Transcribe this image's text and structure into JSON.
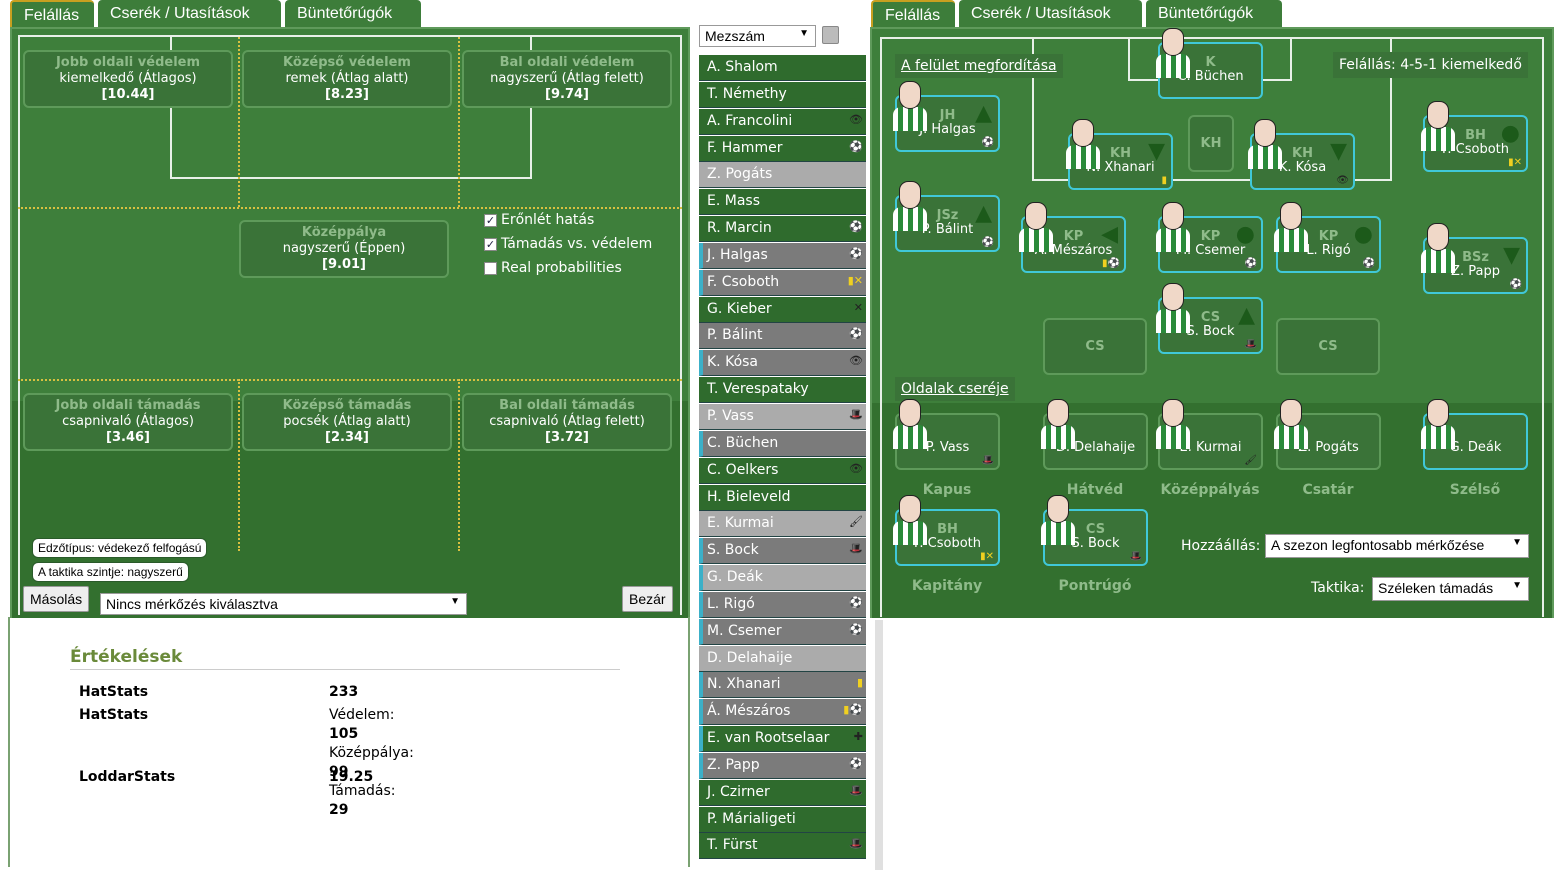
{
  "left": {
    "tabs": [
      "Felállás",
      "Cserék / Utasítások",
      "Büntetőrúgók"
    ],
    "ratings": [
      {
        "title": "Jobb oldali védelem",
        "level": "kiemelkedő (Átlagos)",
        "value": "[10.44]"
      },
      {
        "title": "Középső védelem",
        "level": "remek (Átlag alatt)",
        "value": "[8.23]"
      },
      {
        "title": "Bal oldali védelem",
        "level": "nagyszerű (Átlag felett)",
        "value": "[9.74]"
      },
      {
        "title": "Középpálya",
        "level": "nagyszerű (Éppen)",
        "value": "[9.01]"
      },
      {
        "title": "Jobb oldali támadás",
        "level": "csapnivaló (Átlagos)",
        "value": "[3.46]"
      },
      {
        "title": "Középső támadás",
        "level": "pocsék (Átlag alatt)",
        "value": "[2.34]"
      },
      {
        "title": "Bal oldali támadás",
        "level": "csapnivaló (Átlag felett)",
        "value": "[3.72]"
      }
    ],
    "checkboxes": [
      {
        "label": "Erőnlét hatás",
        "checked": true
      },
      {
        "label": "Támadás vs. védelem",
        "checked": true
      },
      {
        "label": "Real probabilities",
        "checked": false
      }
    ],
    "coach": "Edzőtípus: védekező felfogású",
    "tactic_level": "A taktika szintje: nagyszerű",
    "copy_button": "Másolás",
    "match_select": "Nincs mérkőzés kiválasztva",
    "close_button": "Bezár",
    "ratings_section": {
      "title": "Értékelések",
      "rows": [
        {
          "label": "HatStats",
          "value": "233"
        },
        {
          "label": "HatStats",
          "lines": [
            {
              "k": "Védelem:",
              "v": "105"
            },
            {
              "k": "Középpálya:",
              "v": "99"
            },
            {
              "k": "Támadás:",
              "v": "29"
            }
          ]
        },
        {
          "label": "LoddarStats",
          "value": "19.25"
        }
      ]
    }
  },
  "list": {
    "sort_select": "Mezszám",
    "players": [
      {
        "name": "A. Shalom",
        "style": "g"
      },
      {
        "name": "T. Némethy",
        "style": "g"
      },
      {
        "name": "A. Francolini",
        "style": "g",
        "icon": "eye"
      },
      {
        "name": "F. Hammer",
        "style": "g",
        "icon": "head"
      },
      {
        "name": "Z. Pogáts",
        "style": "l"
      },
      {
        "name": "E. Mass",
        "style": "g"
      },
      {
        "name": "R. Marcin",
        "style": "g",
        "icon": "head"
      },
      {
        "name": "J. Halgas",
        "style": "d",
        "sel": true,
        "icon": "head"
      },
      {
        "name": "F. Csoboth",
        "style": "d",
        "sel": true,
        "icon": "card-captain"
      },
      {
        "name": "G. Kieber",
        "style": "g",
        "icon": "captain"
      },
      {
        "name": "P. Bálint",
        "style": "d",
        "icon": "head"
      },
      {
        "name": "K. Kósa",
        "style": "d",
        "sel": true,
        "icon": "eye"
      },
      {
        "name": "T. Verespataky",
        "style": "g"
      },
      {
        "name": "P. Vass",
        "style": "l",
        "icon": "hat"
      },
      {
        "name": "C. Büchen",
        "style": "d",
        "sel": true
      },
      {
        "name": "C. Oelkers",
        "style": "g",
        "icon": "eye"
      },
      {
        "name": "H. Bieleveld",
        "style": "g"
      },
      {
        "name": "E. Kurmai",
        "style": "l",
        "icon": "brush"
      },
      {
        "name": "S. Bock",
        "style": "d",
        "sel": true,
        "icon": "hat"
      },
      {
        "name": "G. Deák",
        "style": "l",
        "sel": true
      },
      {
        "name": "L. Rigó",
        "style": "d",
        "sel": true,
        "icon": "head"
      },
      {
        "name": "M. Csemer",
        "style": "d",
        "sel": true,
        "icon": "head"
      },
      {
        "name": "D. Delahaije",
        "style": "l"
      },
      {
        "name": "N. Xhanari",
        "style": "d",
        "sel": true,
        "icon": "card"
      },
      {
        "name": "Á. Mészáros",
        "style": "d",
        "sel": true,
        "icon": "card-head"
      },
      {
        "name": "E. van Rootselaar",
        "style": "g",
        "sel": true,
        "icon": "injury-hat"
      },
      {
        "name": "Z. Papp",
        "style": "d",
        "sel": true,
        "icon": "head"
      },
      {
        "name": "J. Czirner",
        "style": "g",
        "icon": "hat"
      },
      {
        "name": "P. Márialigeti",
        "style": "g"
      },
      {
        "name": "T. Fürst",
        "style": "g",
        "icon": "hat"
      }
    ]
  },
  "right": {
    "tabs": [
      "Felállás",
      "Cserék / Utasítások",
      "Büntetőrúgók"
    ],
    "flip_link": "A felület megfordítása",
    "formation": "Felállás: 4-5-1 kiemelkedő",
    "swap_link": "Oldalak cseréje",
    "lineup": [
      {
        "pos": "K",
        "name": "C. Büchen"
      },
      {
        "pos": "JH",
        "name": "J. Halgas",
        "order": "up",
        "icon": "head"
      },
      {
        "pos": "KH",
        "name": "N. Xhanari",
        "order": "down",
        "icon": "card"
      },
      {
        "pos": "KH",
        "name": "K. Kósa",
        "order": "down",
        "icon": "eye"
      },
      {
        "pos": "BH",
        "name": "F. Csoboth",
        "order": "normal",
        "icon": "card-captain"
      },
      {
        "pos": "JSz",
        "name": "P. Bálint",
        "order": "up",
        "icon": "head"
      },
      {
        "pos": "KP",
        "name": "A. Mészáros",
        "order": "left",
        "icon": "card-head"
      },
      {
        "pos": "KP",
        "name": "M. Csemer",
        "order": "normal",
        "icon": "head"
      },
      {
        "pos": "KP",
        "name": "L. Rigó",
        "order": "normal",
        "icon": "head"
      },
      {
        "pos": "BSz",
        "name": "Z. Papp",
        "order": "down",
        "icon": "head"
      },
      {
        "pos": "CS",
        "name": "S. Bock",
        "order": "up",
        "icon": "hat"
      }
    ],
    "empty_slots": [
      "KH",
      "CS",
      "CS"
    ],
    "subs": [
      {
        "name": "P. Vass",
        "label": "Kapus",
        "icon": "hat"
      },
      {
        "name": "D. Delahaije",
        "label": "Hátvéd"
      },
      {
        "name": "E. Kurmai",
        "label": "Középpályás",
        "icon": "brush"
      },
      {
        "name": "Z. Pogáts",
        "label": "Csatár"
      },
      {
        "name": "G. Deák",
        "label": "Szélső"
      }
    ],
    "captain": {
      "pos": "BH",
      "name": "F. Csoboth",
      "label": "Kapitány",
      "icon": "card-captain"
    },
    "setpieces": {
      "pos": "CS",
      "name": "S. Bock",
      "label": "Pontrúgó",
      "icon": "hat"
    },
    "attitude_label": "Hozzáállás:",
    "attitude": "A szezon legfontosabb mérkőzése",
    "tactic_label": "Taktika:",
    "tactic": "Széleken támadás"
  },
  "colors": {
    "field": "#3e7f3b",
    "selected_border": "#40c8d8",
    "tab_active": "#c8a020"
  }
}
